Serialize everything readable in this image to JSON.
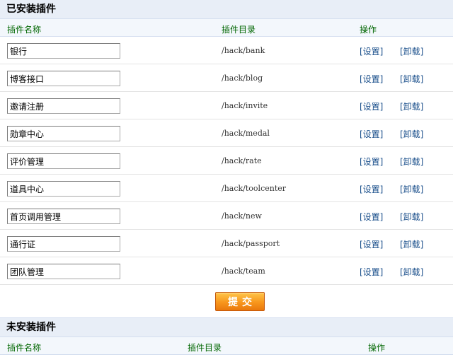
{
  "installed": {
    "title": "已安装插件",
    "columns": {
      "name": "插件名称",
      "dir": "插件目录",
      "ops": "操作"
    },
    "rows": [
      {
        "name": "银行",
        "dir": "/hack/bank",
        "setting": "[设置]",
        "uninstall": "[卸载]"
      },
      {
        "name": "博客接口",
        "dir": "/hack/blog",
        "setting": "[设置]",
        "uninstall": "[卸载]"
      },
      {
        "name": "邀请注册",
        "dir": "/hack/invite",
        "setting": "[设置]",
        "uninstall": "[卸载]"
      },
      {
        "name": "勋章中心",
        "dir": "/hack/medal",
        "setting": "[设置]",
        "uninstall": "[卸载]"
      },
      {
        "name": "评价管理",
        "dir": "/hack/rate",
        "setting": "[设置]",
        "uninstall": "[卸载]"
      },
      {
        "name": "道具中心",
        "dir": "/hack/toolcenter",
        "setting": "[设置]",
        "uninstall": "[卸载]"
      },
      {
        "name": "首页调用管理",
        "dir": "/hack/new",
        "setting": "[设置]",
        "uninstall": "[卸载]"
      },
      {
        "name": "通行证",
        "dir": "/hack/passport",
        "setting": "[设置]",
        "uninstall": "[卸载]"
      },
      {
        "name": "团队管理",
        "dir": "/hack/team",
        "setting": "[设置]",
        "uninstall": "[卸载]"
      }
    ],
    "submit_label": "提交"
  },
  "uninstalled": {
    "title": "未安装插件",
    "columns": {
      "name": "插件名称",
      "dir": "插件目录",
      "ops": "操作"
    }
  },
  "colors": {
    "header_bg": "#e8eef7",
    "column_text": "#006600",
    "link": "#1a4f8b",
    "button": "#f8961c"
  }
}
